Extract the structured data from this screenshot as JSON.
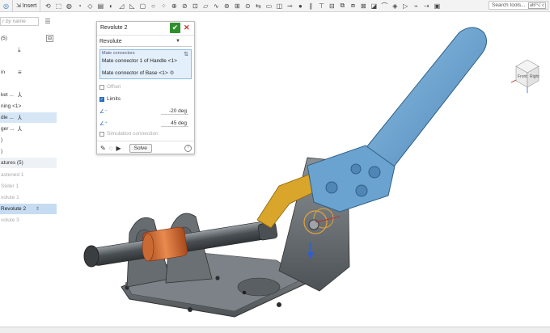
{
  "toolbar": {
    "insert_label": "Insert",
    "search_placeholder": "Search tools...",
    "search_shortcut": "alt/⌥ c",
    "icons": [
      "undo-icon",
      "extrude-icon",
      "revolve-icon",
      "sweep-icon",
      "loft-icon",
      "thicken-icon",
      "fillet-icon",
      "chamfer-icon",
      "draft-icon",
      "shell-icon",
      "hole-icon",
      "pattern-icon",
      "boolean-icon",
      "split-icon",
      "transform-icon",
      "plane-icon",
      "helix-icon",
      "mate-connector-icon",
      "fasten-icon",
      "revolute-icon",
      "slider-icon",
      "planar-icon",
      "cylindrical-icon",
      "pin-slot-icon",
      "ball-icon",
      "parallel-icon",
      "tangent-icon",
      "group-icon",
      "replicate-icon",
      "mirror-icon",
      "explode-icon",
      "section-icon",
      "measure-icon",
      "appearance-icon",
      "animate-icon",
      "simulation-icon",
      "motion-icon",
      "snapshot-icon"
    ]
  },
  "sidebar": {
    "filter_placeholder": "r by name",
    "parts_label": "(5)",
    "instances": [
      {
        "label": "in",
        "icon": "≡"
      },
      {
        "label": "ket ...",
        "icon": "⅄"
      },
      {
        "label": "ning <1>",
        "icon": ""
      },
      {
        "label": "dle ...",
        "icon": "⅄"
      },
      {
        "label": "ger ...",
        "icon": "⅄"
      },
      {
        "label": ")",
        "icon": ""
      },
      {
        "label": ")",
        "icon": ""
      }
    ],
    "features_label": "atures (5)",
    "features": [
      {
        "label": "astened 1"
      },
      {
        "label": "Slider 1"
      },
      {
        "label": "volute 1"
      },
      {
        "label": "Revolute 2"
      },
      {
        "label": "volute 3"
      }
    ]
  },
  "dialog": {
    "title": "Revolute 2",
    "mate_type": "Revolute",
    "mate_connectors_label": "Mate connectors",
    "connector_1": "Mate connector 1 of Handle <1>",
    "connector_2": "Mate connector of Base <1>",
    "offset_label": "Offset",
    "limits_label": "Limits",
    "limit_min": "-20 deg",
    "limit_max": "45 deg",
    "simulation_label": "Simulation connection",
    "solve_label": "Solve",
    "help_label": "?"
  },
  "viewcube": {
    "front_label": "Front",
    "right_label": "Right"
  },
  "colors": {
    "handle_blue": "#5b9ac9",
    "base_gray": "#6f7478",
    "yellow_link": "#d9a52a",
    "copper": "#c8622b",
    "ok_green": "#2f8f2f",
    "selection_blue": "#d6e6f5"
  }
}
